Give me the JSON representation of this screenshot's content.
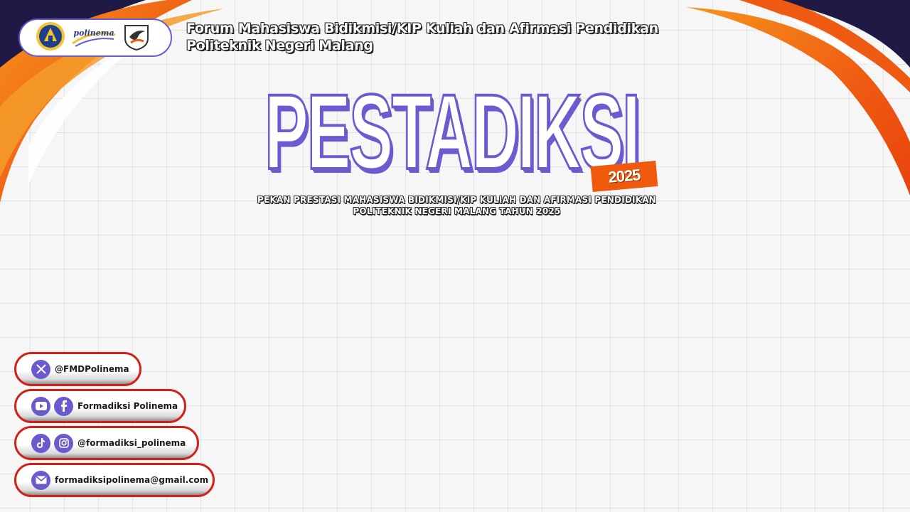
{
  "header": {
    "logos": [
      "university-seal-logo",
      "polinema-logo",
      "formadiksi-eagle-logo"
    ],
    "logo_wordmark": "polinema",
    "title_line1": "Forum Mahasiswa Bidikmisi/KIP Kuliah dan Afirmasi Pendidikan",
    "title_line2": "Politeknik Negeri Malang"
  },
  "brand": {
    "name": "PESTADIKSI",
    "year": "2025",
    "subtitle_line1": "PEKAN PRESTASI MAHASISWA BIDIKMISI/KIP KULIAH DAN AFIRMASI PENDIDIKAN",
    "subtitle_line2": "POLITEKNIK NEGERI MALANG TAHUN 2025"
  },
  "contacts": [
    {
      "icons": [
        "x-twitter-icon"
      ],
      "text": "@FMDPolinema"
    },
    {
      "icons": [
        "youtube-icon",
        "facebook-icon"
      ],
      "text": "Formadiksi Polinema"
    },
    {
      "icons": [
        "tiktok-icon",
        "instagram-icon"
      ],
      "text": "@formadiksi_polinema"
    },
    {
      "icons": [
        "email-icon"
      ],
      "text": "formadiksipolinema@gmail.com"
    }
  ],
  "colors": {
    "accent_purple": "#6a5acd",
    "accent_orange": "#f05a0c",
    "navy": "#1f1946",
    "pill_border_red": "#d22218"
  }
}
